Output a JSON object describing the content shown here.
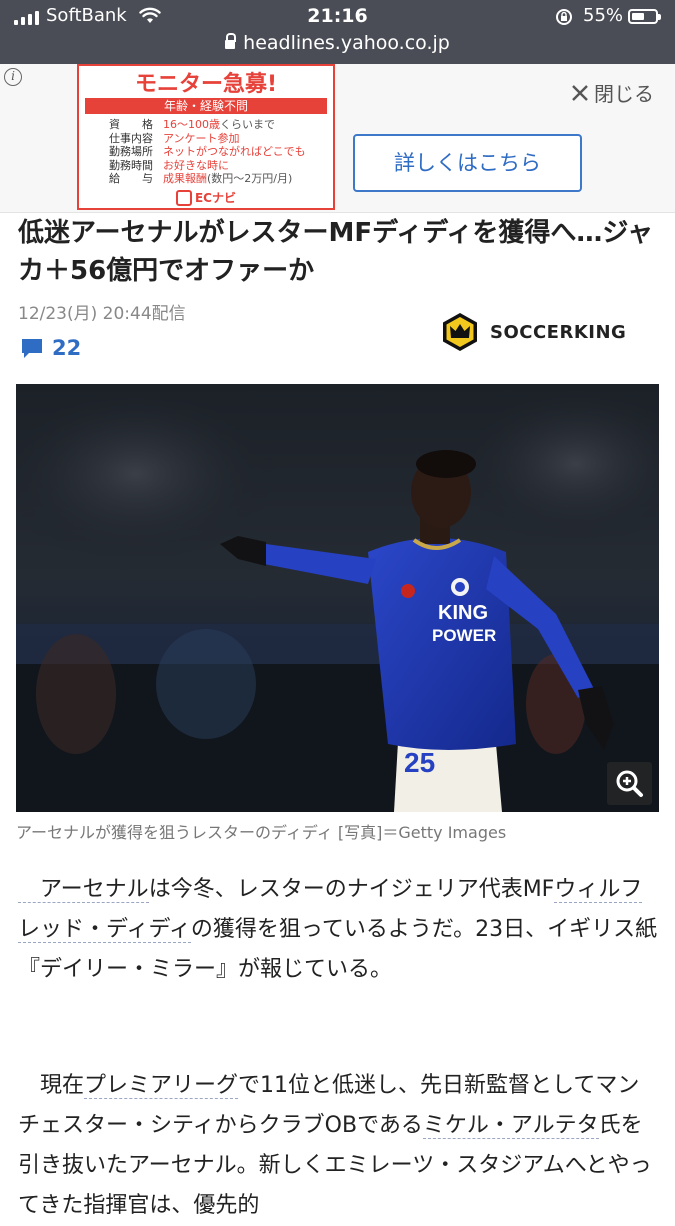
{
  "status": {
    "carrier": "SoftBank",
    "time": "21:16",
    "battery_percent": "55%",
    "battery_level": 0.55
  },
  "browser": {
    "url": "headlines.yahoo.co.jp"
  },
  "ad": {
    "headline": "モニター急募!",
    "banner": "年齢・経験不問",
    "rows": [
      {
        "key": "資　　格",
        "value": "16〜100歳",
        "rest": "くらいまで"
      },
      {
        "key": "仕事内容",
        "value": "アンケート参加",
        "rest": ""
      },
      {
        "key": "勤務場所",
        "value": "ネットがつながればどこでも",
        "rest": ""
      },
      {
        "key": "勤務時間",
        "value": "お好きな時に",
        "rest": ""
      },
      {
        "key": "給　　与",
        "value": "成果報酬",
        "rest": "(数円〜2万円/月)"
      }
    ],
    "logo": "ECナビ",
    "close_label": "閉じる",
    "cta_label": "詳しくはこちら"
  },
  "article": {
    "title": "低迷アーセナルがレスターMFディディを獲得へ…ジャカ＋56億円でオファーか",
    "date": "12/23(月) 20:44配信",
    "comment_count": "22",
    "source": "SOCCERKING",
    "caption": "アーセナルが獲得を狙うレスターのディディ [写真]＝Getty Images",
    "jersey_sponsor_1": "KING",
    "jersey_sponsor_2": "POWER",
    "jersey_number": "25",
    "p1_pre": "　アーセナル",
    "p1_a": "は今冬、レスターのナイジェリア代表MF",
    "p1_link": "ウィルフレッド・ディディ",
    "p1_b": "の獲得を狙っているようだ。23日、イギリス紙『デイリー・ミラー』が報じている。",
    "p2_pre": "　現在",
    "p2_link": "プレミアリーグ",
    "p2_a": "で11位と低迷し、先日新監督としてマンチェスター・シティからクラブOBである",
    "p2_link2": "ミケル・アルテタ",
    "p2_b": "氏を引き抜いたアーセナル。新しくエミレーツ・スタジアムへとやってきた指揮官は、優先的"
  }
}
